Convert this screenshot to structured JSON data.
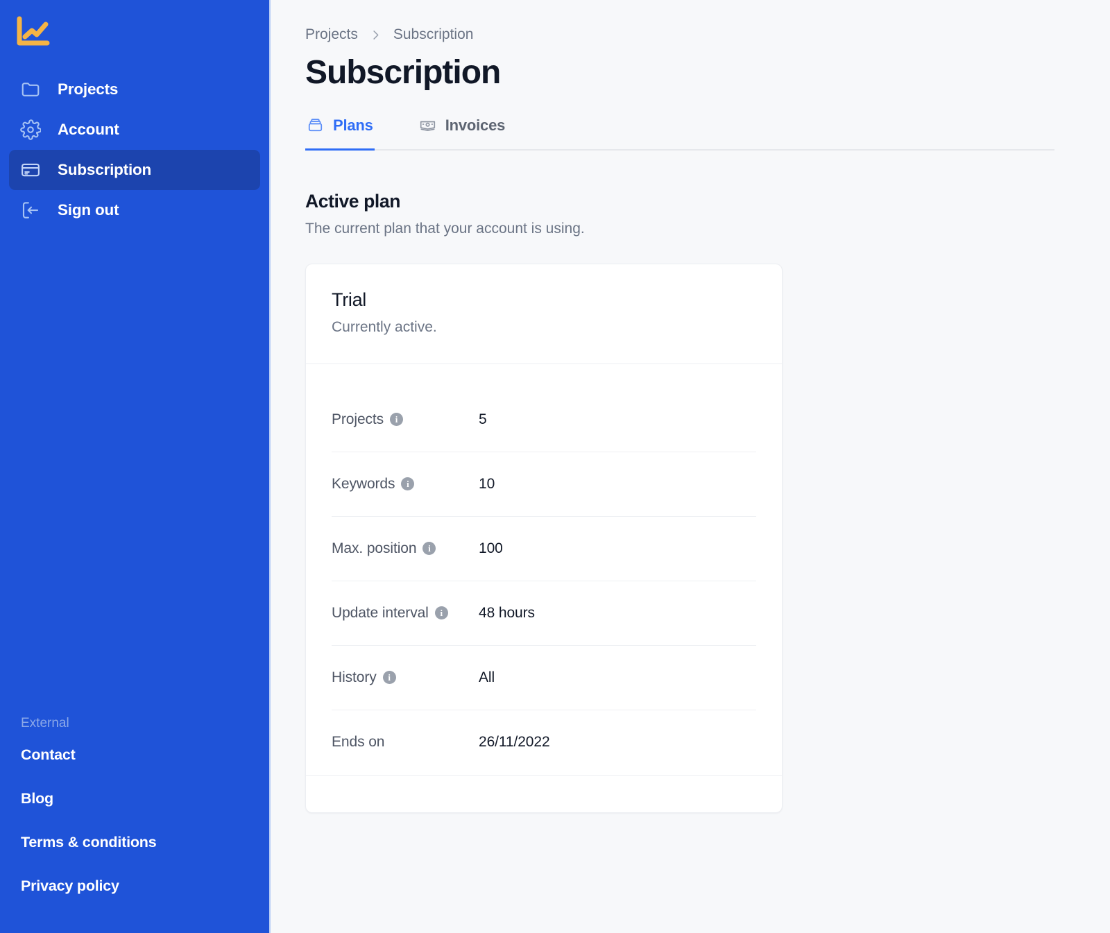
{
  "sidebar": {
    "logo": {
      "icon": "line-chart-logo-icon",
      "color": "#f5b445"
    },
    "nav": [
      {
        "id": "projects",
        "label": "Projects",
        "icon": "folder-icon",
        "active": false
      },
      {
        "id": "account",
        "label": "Account",
        "icon": "gear-icon",
        "active": false
      },
      {
        "id": "subscription",
        "label": "Subscription",
        "icon": "credit-card-icon",
        "active": true
      },
      {
        "id": "sign-out",
        "label": "Sign out",
        "icon": "sign-out-icon",
        "active": false
      }
    ],
    "external": {
      "heading": "External",
      "links": [
        {
          "id": "contact",
          "label": "Contact"
        },
        {
          "id": "blog",
          "label": "Blog"
        },
        {
          "id": "terms",
          "label": "Terms & conditions"
        },
        {
          "id": "privacy",
          "label": "Privacy policy"
        }
      ]
    },
    "colors": {
      "background": "#1f53d8",
      "active_item": "#1c44ae",
      "icon": "#a6c2f4",
      "heading": "#8ba8e8"
    }
  },
  "breadcrumb": {
    "parent": "Projects",
    "separator": "chevron-right-icon",
    "current": "Subscription"
  },
  "header": {
    "title": "Subscription"
  },
  "tabs": [
    {
      "id": "plans",
      "label": "Plans",
      "icon": "archive-box-icon",
      "active": true
    },
    {
      "id": "invoices",
      "label": "Invoices",
      "icon": "banknote-icon",
      "active": false
    }
  ],
  "section": {
    "title": "Active plan",
    "subtitle": "The current plan that your account is using."
  },
  "plan_card": {
    "name": "Trial",
    "status": "Currently active.",
    "specs": [
      {
        "label": "Projects",
        "value": "5",
        "has_info": true
      },
      {
        "label": "Keywords",
        "value": "10",
        "has_info": true
      },
      {
        "label": "Max. position",
        "value": "100",
        "has_info": true
      },
      {
        "label": "Update interval",
        "value": "48 hours",
        "has_info": true
      },
      {
        "label": "History",
        "value": "All",
        "has_info": true
      },
      {
        "label": "Ends on",
        "value": "26/11/2022",
        "has_info": false
      }
    ]
  },
  "colors": {
    "accent": "#2f6df6",
    "page_background": "#f7f8fa",
    "card_background": "#ffffff",
    "text_primary": "#111827",
    "text_secondary": "#6b7485"
  }
}
